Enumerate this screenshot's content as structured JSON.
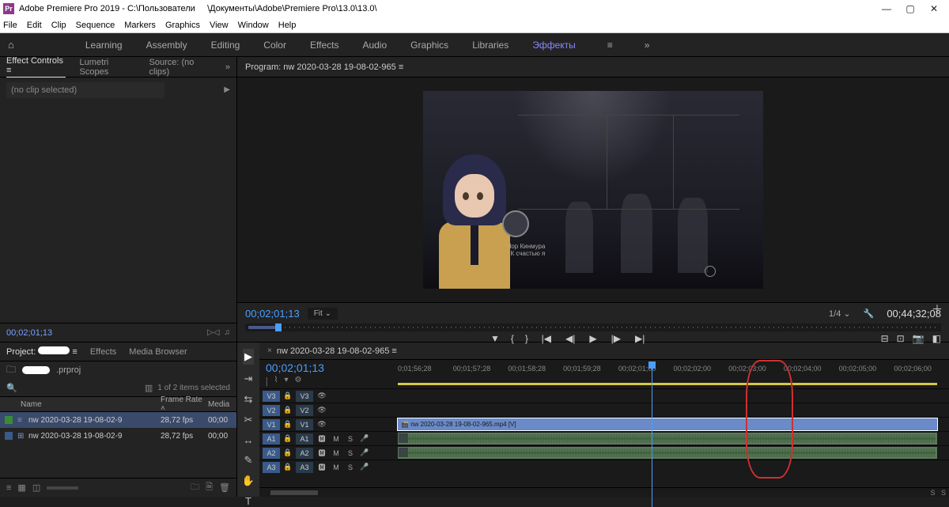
{
  "titlebar": {
    "app": "Adobe Premiere Pro 2019",
    "path1": "C:\\Пользователи",
    "path2": "\\Документы\\Adobe\\Premiere Pro\\13.0\\13.0\\"
  },
  "menubar": [
    "File",
    "Edit",
    "Clip",
    "Sequence",
    "Markers",
    "Graphics",
    "View",
    "Window",
    "Help"
  ],
  "workspaces": [
    "Learning",
    "Assembly",
    "Editing",
    "Color",
    "Effects",
    "Audio",
    "Graphics",
    "Libraries",
    "Эффекты"
  ],
  "effect_panel": {
    "tabs": [
      "Effect Controls",
      "Lumetri Scopes",
      "Source: (no clips)"
    ],
    "no_clip": "(no clip selected)",
    "timecode": "00;02;01;13"
  },
  "program_panel": {
    "title": "Program: nw 2020-03-28 19-08-02-965",
    "timecode": "00;02;01;13",
    "fit": "Fit",
    "zoom": "1/4",
    "duration": "00;44;32;08",
    "subtitle_name": "Нор Кинмура",
    "subtitle_text": "- К счастью я"
  },
  "project_panel": {
    "tabs": [
      "Project:",
      "Effects",
      "Media Browser"
    ],
    "prproj": ".prproj",
    "selected": "1 of 2 items selected",
    "columns": {
      "name": "Name",
      "fr": "Frame Rate",
      "md": "Media"
    },
    "items": [
      {
        "name": "nw 2020-03-28 19-08-02-9",
        "fr": "28,72 fps",
        "md": "00;00",
        "swatch": "g",
        "icon": "≡"
      },
      {
        "name": "nw 2020-03-28 19-08-02-9",
        "fr": "28,72 fps",
        "md": "00;00",
        "swatch": "b",
        "icon": "⊞"
      }
    ]
  },
  "timeline": {
    "seq_name": "nw 2020-03-28 19-08-02-965",
    "timecode": "00;02;01;13",
    "ruler": [
      "0;01;56;28",
      "00;01;57;28",
      "00;01;58;28",
      "00;01;59;28",
      "00;02;01;00",
      "00;02;02;00",
      "00;02;03;00",
      "00;02;04;00",
      "00;02;05;00",
      "00;02;06;00"
    ],
    "video_tracks": [
      "V3",
      "V2",
      "V1"
    ],
    "audio_tracks": [
      "A1",
      "A2",
      "A3"
    ],
    "clip_label": "nw 2020-03-28 19-08-02-965.mp4 [V]"
  }
}
